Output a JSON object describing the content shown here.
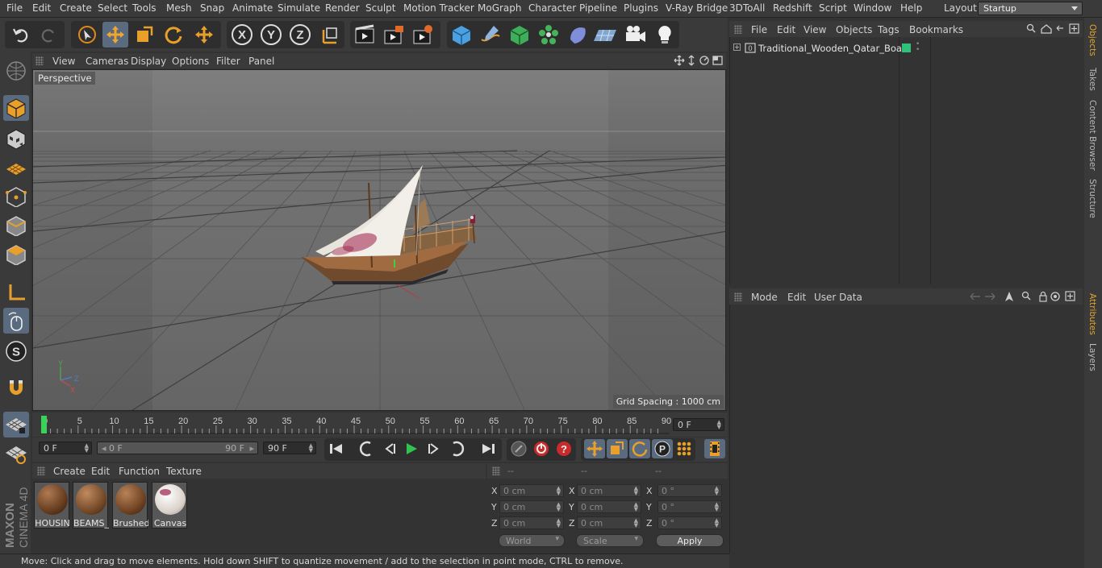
{
  "menubar": {
    "items": [
      "File",
      "Edit",
      "Create",
      "Select",
      "Tools",
      "Mesh",
      "Snap",
      "Animate",
      "Simulate",
      "Render",
      "Sculpt",
      "Motion Tracker",
      "MoGraph",
      "Character",
      "Pipeline",
      "Plugins",
      "V-Ray Bridge",
      "3DToAll",
      "Redshift",
      "Script",
      "Window",
      "Help"
    ],
    "layout_label": "Layout:",
    "layout_value": "Startup"
  },
  "toolbar": {
    "axis_labels": [
      "X",
      "Y",
      "Z"
    ],
    "icons": [
      "undo-icon",
      "redo-icon",
      "live-selection-icon",
      "move-icon",
      "scale-icon",
      "rotate-icon",
      "last-tool-icon",
      "x-axis-lock",
      "y-axis-lock",
      "z-axis-lock",
      "coordinate-system-icon",
      "render-view-icon",
      "render-picture-viewer-icon",
      "edit-render-settings-icon",
      "cube-primitive-icon",
      "pen-spline-icon",
      "subdivision-surface-icon",
      "cloner-icon",
      "deformer-icon",
      "floor-icon",
      "camera-icon",
      "light-icon"
    ]
  },
  "viewport": {
    "menu": [
      "View",
      "Cameras",
      "Display",
      "Options",
      "Filter",
      "Panel"
    ],
    "label": "Perspective",
    "grid_spacing": "Grid Spacing : 1000 cm",
    "axis_labels": [
      "Y",
      "Z",
      "X"
    ]
  },
  "timeline": {
    "ticks": [
      "0",
      "5",
      "10",
      "15",
      "20",
      "25",
      "30",
      "35",
      "40",
      "45",
      "50",
      "55",
      "60",
      "65",
      "70",
      "75",
      "80",
      "85",
      "90"
    ],
    "current_frame": "0 F"
  },
  "playbar": {
    "start_field": "0 F",
    "range_start": "0 F",
    "range_end": "90 F",
    "end_field": "90 F"
  },
  "material_manager": {
    "menu": [
      "Create",
      "Edit",
      "Function",
      "Texture"
    ],
    "materials": [
      {
        "name": "HOUSIN",
        "color": "#7a4a2c"
      },
      {
        "name": "BEAMS_",
        "color": "#8a5836"
      },
      {
        "name": "Brushed",
        "color": "#7f5233"
      },
      {
        "name": "Canvas",
        "color": "#e8e2dc"
      }
    ]
  },
  "coordinates": {
    "headers": [
      "--",
      "--",
      "--"
    ],
    "rows": [
      {
        "axis": "X",
        "pos": "0 cm",
        "size": "0 cm",
        "rot": "0 °"
      },
      {
        "axis": "Y",
        "pos": "0 cm",
        "size": "0 cm",
        "rot": "0 °"
      },
      {
        "axis": "Z",
        "pos": "0 cm",
        "size": "0 cm",
        "rot": "0 °"
      }
    ],
    "mode_world": "World",
    "mode_scale": "Scale",
    "apply_label": "Apply"
  },
  "object_manager": {
    "menu": [
      "File",
      "Edit",
      "View",
      "Objects",
      "Tags",
      "Bookmarks"
    ],
    "objects": [
      {
        "name": "Traditional_Wooden_Qatar_Boat",
        "tag_color": "#2fc37a"
      }
    ]
  },
  "attribute_manager": {
    "menu": [
      "Mode",
      "Edit",
      "User Data"
    ]
  },
  "right_tabs": [
    "Objects",
    "Takes",
    "Content Browser",
    "Structure",
    "Attributes",
    "Layers"
  ],
  "status": {
    "text": "Move: Click and drag to move elements. Hold down SHIFT to quantize movement / add to the selection in point mode, CTRL to remove."
  },
  "logo": {
    "brand": "MAXON",
    "product": "CINEMA 4D"
  },
  "colors": {
    "accent": "#e3a52c",
    "selected": "#5a6b80",
    "tag": "#2fc37a"
  }
}
